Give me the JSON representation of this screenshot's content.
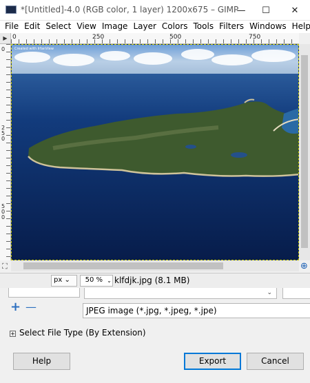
{
  "window": {
    "title": "*[Untitled]-4.0 (RGB color, 1 layer) 1200x675 – GIMP",
    "min_glyph": "—",
    "max_glyph": "☐",
    "close_glyph": "✕"
  },
  "menu": [
    "File",
    "Edit",
    "Select",
    "View",
    "Image",
    "Layer",
    "Colors",
    "Tools",
    "Filters",
    "Windows",
    "Help"
  ],
  "rulers": {
    "horizontal": [
      "0",
      "250",
      "500",
      "750"
    ],
    "vertical": [
      "0",
      "250",
      "500"
    ]
  },
  "canvas": {
    "caption": "Created with IrfanView",
    "image_description_colors": {
      "sea": "#0d2a61",
      "sky": "#b9cfe6",
      "land": "#3e5a2e"
    }
  },
  "status": {
    "unit": "px",
    "zoom": "50 %",
    "file_info": "klfdjk.jpg (8.1 MB)"
  },
  "dialog": {
    "add_glyph": "+",
    "remove_glyph": "—",
    "file_filter": "JPEG image (*.jpg, *.jpeg, *.jpe)",
    "select_type_label": "Select File Type (By Extension)",
    "expander_glyph": "+",
    "buttons": {
      "help": "Help",
      "export": "Export",
      "cancel": "Cancel"
    }
  },
  "icons": {
    "navigate": "⊕",
    "chevron": "⌄"
  }
}
